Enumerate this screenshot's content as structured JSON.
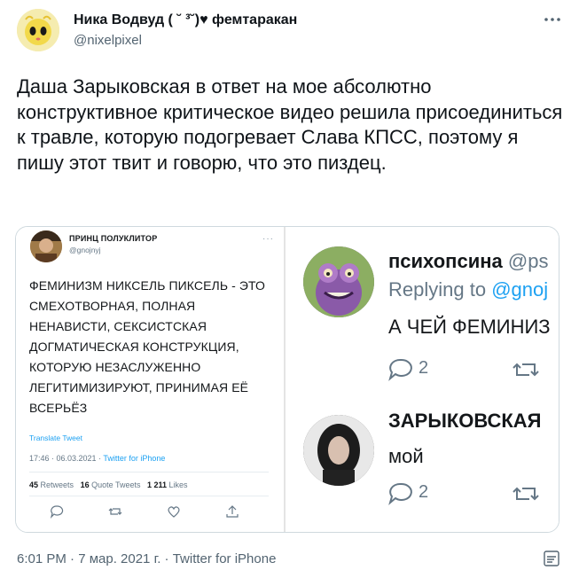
{
  "header": {
    "display_name": "Ника Водвуд ( ˘ ³˘)♥ фемтаракан",
    "handle": "@nixelpixel"
  },
  "tweet": {
    "text": "Даша Зарыковская в ответ на мое абсолютно конструктивное критическое видео решила присоединиться к травле, которую подогревает Слава КПСС, поэтому я пишу этот твит и говорю, что это пиздец.",
    "timestamp": "6:01 PM · 7 мар. 2021 г. · Twitter for iPhone"
  },
  "media": {
    "left_tweet": {
      "name": "ПРИНЦ ПОЛУКЛИТОР",
      "handle": "@gnojnyj",
      "more": "···",
      "body": "ФЕМИНИЗМ НИКСЕЛЬ ПИКСЕЛЬ - ЭТО СМЕХОТВОРНАЯ, ПОЛНАЯ НЕНАВИСТИ, СЕКСИСТСКАЯ ДОГМАТИЧЕСКАЯ КОНСТРУКЦИЯ, КОТОРУЮ НЕЗАСЛУЖЕННО ЛЕГИТИМИЗИРУЮТ, ПРИНИМАЯ ЕЁ ВСЕРЬЁЗ",
      "translate": "Translate Tweet",
      "time": "17:46 · 06.03.2021 · ",
      "source": "Twitter for iPhone",
      "retweets_count": "45",
      "retweets_label": "Retweets",
      "quotes_count": "16",
      "quotes_label": "Quote Tweets",
      "likes_count": "1 211",
      "likes_label": "Likes"
    },
    "right_replies": {
      "reply1_name": "психопсина",
      "reply1_handle": "@ps",
      "replying_label": "Replying to ",
      "replying_handle": "@gnoj",
      "reply1_text": "А ЧЕЙ ФЕМИНИЗ",
      "reply1_replies": "2",
      "reply2_name": "ЗАРЫКОВСКАЯ",
      "reply2_text": "мой",
      "reply2_replies": "2"
    }
  },
  "colors": {
    "link": "#1da1f2",
    "secondary": "#536471",
    "border": "#cfd9de"
  }
}
